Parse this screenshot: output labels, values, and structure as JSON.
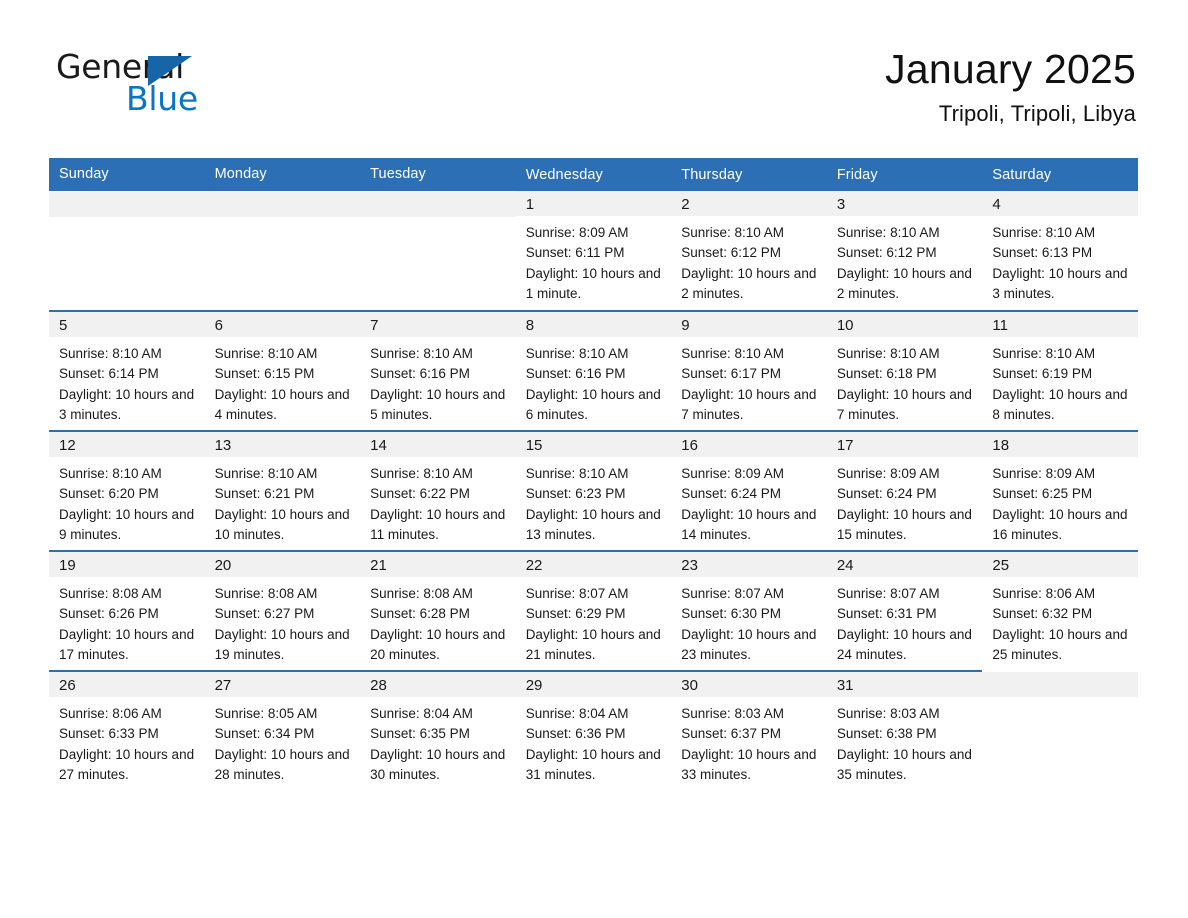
{
  "logo": {
    "word_top": "General",
    "word_bottom": "Blue",
    "triangle_icon": "triangle-icon",
    "accent_color": "#1565a8",
    "blue_text_color": "#0b74c4"
  },
  "header": {
    "month_title": "January 2025",
    "location": "Tripoli, Tripoli, Libya"
  },
  "theme": {
    "header_blue": "#2c6fb4",
    "day_band_gray": "#f1f1f1",
    "text_color": "#1a1a1a"
  },
  "weekday_headers": [
    "Sunday",
    "Monday",
    "Tuesday",
    "Wednesday",
    "Thursday",
    "Friday",
    "Saturday"
  ],
  "labels": {
    "sunrise_prefix": "Sunrise:",
    "sunset_prefix": "Sunset:",
    "daylight_prefix": "Daylight:"
  },
  "weeks": [
    [
      {
        "day": "",
        "sunrise": "",
        "sunset": "",
        "daylight": "",
        "empty": true
      },
      {
        "day": "",
        "sunrise": "",
        "sunset": "",
        "daylight": "",
        "empty": true
      },
      {
        "day": "",
        "sunrise": "",
        "sunset": "",
        "daylight": "",
        "empty": true
      },
      {
        "day": "1",
        "sunrise": "Sunrise: 8:09 AM",
        "sunset": "Sunset: 6:11 PM",
        "daylight": "Daylight: 10 hours and 1 minute."
      },
      {
        "day": "2",
        "sunrise": "Sunrise: 8:10 AM",
        "sunset": "Sunset: 6:12 PM",
        "daylight": "Daylight: 10 hours and 2 minutes."
      },
      {
        "day": "3",
        "sunrise": "Sunrise: 8:10 AM",
        "sunset": "Sunset: 6:12 PM",
        "daylight": "Daylight: 10 hours and 2 minutes."
      },
      {
        "day": "4",
        "sunrise": "Sunrise: 8:10 AM",
        "sunset": "Sunset: 6:13 PM",
        "daylight": "Daylight: 10 hours and 3 minutes."
      }
    ],
    [
      {
        "day": "5",
        "sunrise": "Sunrise: 8:10 AM",
        "sunset": "Sunset: 6:14 PM",
        "daylight": "Daylight: 10 hours and 3 minutes."
      },
      {
        "day": "6",
        "sunrise": "Sunrise: 8:10 AM",
        "sunset": "Sunset: 6:15 PM",
        "daylight": "Daylight: 10 hours and 4 minutes."
      },
      {
        "day": "7",
        "sunrise": "Sunrise: 8:10 AM",
        "sunset": "Sunset: 6:16 PM",
        "daylight": "Daylight: 10 hours and 5 minutes."
      },
      {
        "day": "8",
        "sunrise": "Sunrise: 8:10 AM",
        "sunset": "Sunset: 6:16 PM",
        "daylight": "Daylight: 10 hours and 6 minutes."
      },
      {
        "day": "9",
        "sunrise": "Sunrise: 8:10 AM",
        "sunset": "Sunset: 6:17 PM",
        "daylight": "Daylight: 10 hours and 7 minutes."
      },
      {
        "day": "10",
        "sunrise": "Sunrise: 8:10 AM",
        "sunset": "Sunset: 6:18 PM",
        "daylight": "Daylight: 10 hours and 7 minutes."
      },
      {
        "day": "11",
        "sunrise": "Sunrise: 8:10 AM",
        "sunset": "Sunset: 6:19 PM",
        "daylight": "Daylight: 10 hours and 8 minutes."
      }
    ],
    [
      {
        "day": "12",
        "sunrise": "Sunrise: 8:10 AM",
        "sunset": "Sunset: 6:20 PM",
        "daylight": "Daylight: 10 hours and 9 minutes."
      },
      {
        "day": "13",
        "sunrise": "Sunrise: 8:10 AM",
        "sunset": "Sunset: 6:21 PM",
        "daylight": "Daylight: 10 hours and 10 minutes."
      },
      {
        "day": "14",
        "sunrise": "Sunrise: 8:10 AM",
        "sunset": "Sunset: 6:22 PM",
        "daylight": "Daylight: 10 hours and 11 minutes."
      },
      {
        "day": "15",
        "sunrise": "Sunrise: 8:10 AM",
        "sunset": "Sunset: 6:23 PM",
        "daylight": "Daylight: 10 hours and 13 minutes."
      },
      {
        "day": "16",
        "sunrise": "Sunrise: 8:09 AM",
        "sunset": "Sunset: 6:24 PM",
        "daylight": "Daylight: 10 hours and 14 minutes."
      },
      {
        "day": "17",
        "sunrise": "Sunrise: 8:09 AM",
        "sunset": "Sunset: 6:24 PM",
        "daylight": "Daylight: 10 hours and 15 minutes."
      },
      {
        "day": "18",
        "sunrise": "Sunrise: 8:09 AM",
        "sunset": "Sunset: 6:25 PM",
        "daylight": "Daylight: 10 hours and 16 minutes."
      }
    ],
    [
      {
        "day": "19",
        "sunrise": "Sunrise: 8:08 AM",
        "sunset": "Sunset: 6:26 PM",
        "daylight": "Daylight: 10 hours and 17 minutes."
      },
      {
        "day": "20",
        "sunrise": "Sunrise: 8:08 AM",
        "sunset": "Sunset: 6:27 PM",
        "daylight": "Daylight: 10 hours and 19 minutes."
      },
      {
        "day": "21",
        "sunrise": "Sunrise: 8:08 AM",
        "sunset": "Sunset: 6:28 PM",
        "daylight": "Daylight: 10 hours and 20 minutes."
      },
      {
        "day": "22",
        "sunrise": "Sunrise: 8:07 AM",
        "sunset": "Sunset: 6:29 PM",
        "daylight": "Daylight: 10 hours and 21 minutes."
      },
      {
        "day": "23",
        "sunrise": "Sunrise: 8:07 AM",
        "sunset": "Sunset: 6:30 PM",
        "daylight": "Daylight: 10 hours and 23 minutes."
      },
      {
        "day": "24",
        "sunrise": "Sunrise: 8:07 AM",
        "sunset": "Sunset: 6:31 PM",
        "daylight": "Daylight: 10 hours and 24 minutes."
      },
      {
        "day": "25",
        "sunrise": "Sunrise: 8:06 AM",
        "sunset": "Sunset: 6:32 PM",
        "daylight": "Daylight: 10 hours and 25 minutes."
      }
    ],
    [
      {
        "day": "26",
        "sunrise": "Sunrise: 8:06 AM",
        "sunset": "Sunset: 6:33 PM",
        "daylight": "Daylight: 10 hours and 27 minutes."
      },
      {
        "day": "27",
        "sunrise": "Sunrise: 8:05 AM",
        "sunset": "Sunset: 6:34 PM",
        "daylight": "Daylight: 10 hours and 28 minutes."
      },
      {
        "day": "28",
        "sunrise": "Sunrise: 8:04 AM",
        "sunset": "Sunset: 6:35 PM",
        "daylight": "Daylight: 10 hours and 30 minutes."
      },
      {
        "day": "29",
        "sunrise": "Sunrise: 8:04 AM",
        "sunset": "Sunset: 6:36 PM",
        "daylight": "Daylight: 10 hours and 31 minutes."
      },
      {
        "day": "30",
        "sunrise": "Sunrise: 8:03 AM",
        "sunset": "Sunset: 6:37 PM",
        "daylight": "Daylight: 10 hours and 33 minutes."
      },
      {
        "day": "31",
        "sunrise": "Sunrise: 8:03 AM",
        "sunset": "Sunset: 6:38 PM",
        "daylight": "Daylight: 10 hours and 35 minutes."
      },
      {
        "day": "",
        "sunrise": "",
        "sunset": "",
        "daylight": "",
        "empty": true
      }
    ]
  ]
}
